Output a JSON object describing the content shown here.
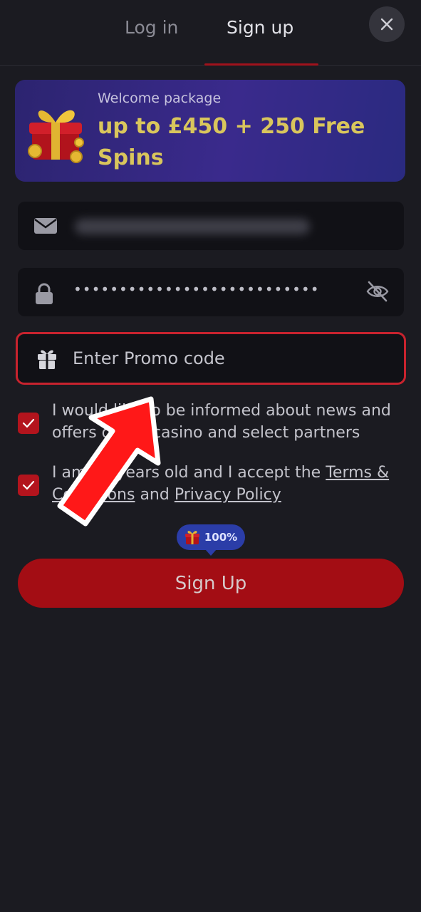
{
  "tabs": {
    "login": "Log in",
    "signup": "Sign up"
  },
  "banner": {
    "subtitle": "Welcome package",
    "title": "up to £450 + 250 Free Spins"
  },
  "form": {
    "password_mask": "•••••••••••••••••••••••••••",
    "promo_placeholder": "Enter Promo code"
  },
  "consents": {
    "news_text": "I would like to be informed about news and offers of the casino and select partners",
    "terms_prefix": "I am 18 years old and I accept the ",
    "terms_link": "Terms & Conditions",
    "terms_and": " and ",
    "privacy_link": "Privacy Policy"
  },
  "badge": {
    "text": "100%"
  },
  "submit": {
    "label": "Sign Up"
  },
  "colors": {
    "accent": "#a30d14",
    "promo_border": "#c8232e",
    "banner_text": "#d9c65c"
  }
}
